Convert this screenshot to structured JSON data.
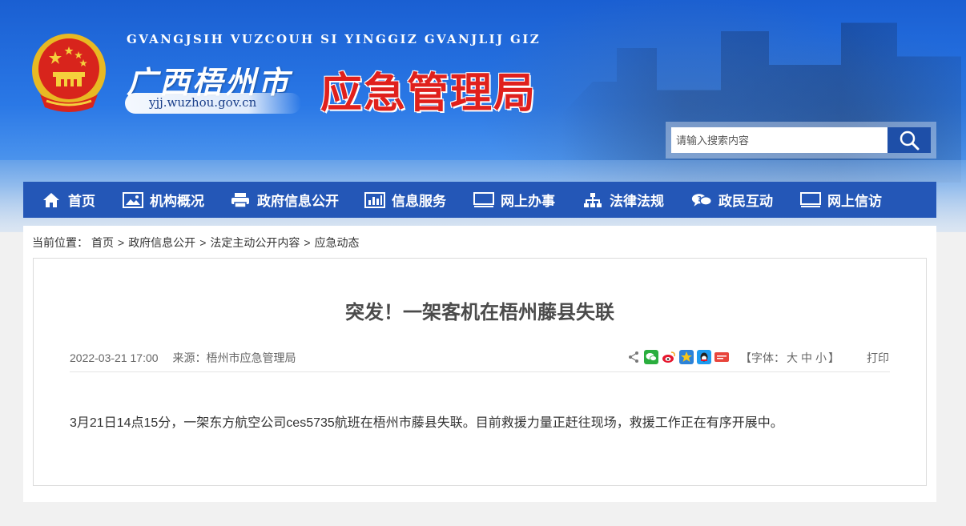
{
  "header": {
    "pinyin": "GVANGJSIH VUZCOUH SI YINGGIZ GVANJLIJ GIZ",
    "city_name": "广西梧州市",
    "domain": "yjj.wuzhou.gov.cn",
    "bureau": "应急管理局",
    "emblem_icon": "national-emblem-icon"
  },
  "search": {
    "placeholder": "请输入搜索内容",
    "icon": "search-icon"
  },
  "nav": {
    "items": [
      {
        "label": "首页",
        "icon": "home-icon"
      },
      {
        "label": "机构概况",
        "icon": "image-icon"
      },
      {
        "label": "政府信息公开",
        "icon": "printer-icon"
      },
      {
        "label": "信息服务",
        "icon": "bar-chart-icon"
      },
      {
        "label": "网上办事",
        "icon": "monitor-icon"
      },
      {
        "label": "法律法规",
        "icon": "sitemap-icon"
      },
      {
        "label": "政民互动",
        "icon": "chat-icon"
      },
      {
        "label": "网上信访",
        "icon": "monitor-icon"
      }
    ]
  },
  "breadcrumb": {
    "prefix": "当前位置：",
    "items": [
      "首页",
      "政府信息公开",
      "法定主动公开内容",
      "应急动态"
    ]
  },
  "article": {
    "title": "突发！一架客机在梧州藤县失联",
    "date": "2022-03-21 17:00",
    "source": "来源：梧州市应急管理局",
    "font_label_open": "【字体：",
    "font_large": "大",
    "font_medium": "中",
    "font_small": "小",
    "font_label_close": "】",
    "print": "打印",
    "body": "3月21日14点15分，一架东方航空公司ces5735航班在梧州市藤县失联。目前救援力量正赶往现场，救援工作正在有序开展中。"
  },
  "colors": {
    "nav_bg": "#2457b7",
    "bureau_red": "#e0201c",
    "search_btn": "#1e4fa8"
  }
}
